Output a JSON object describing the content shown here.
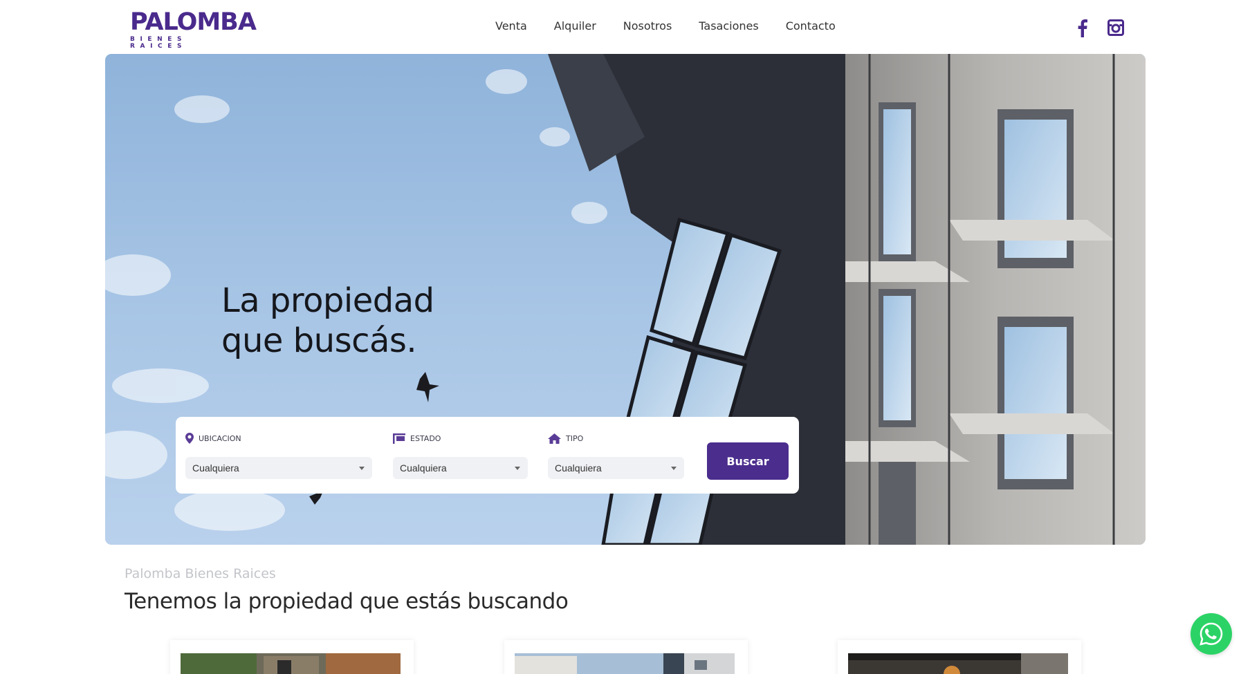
{
  "brand": {
    "name": "PALOMBA",
    "tagline": "BIENES RAICES",
    "color": "#4a2a8c"
  },
  "nav": {
    "items": [
      "Venta",
      "Alquiler",
      "Nosotros",
      "Tasaciones",
      "Contacto"
    ]
  },
  "social": {
    "facebook_icon": "facebook-icon",
    "instagram_icon": "instagram-icon"
  },
  "hero": {
    "title_line1": "La propiedad",
    "title_line2": "que buscás."
  },
  "search": {
    "location": {
      "label": "UBICACION",
      "value": "Cualquiera"
    },
    "status": {
      "label": "ESTADO",
      "value": "Cualquiera"
    },
    "type": {
      "label": "TIPO",
      "value": "Cualquiera"
    },
    "button_label": "Buscar",
    "button_color": "#4b2d8d"
  },
  "section": {
    "kicker": "Palomba Bienes Raices",
    "title": "Tenemos la propiedad que estás buscando"
  },
  "whatsapp": {
    "icon": "whatsapp-icon",
    "color": "#2bd366"
  }
}
